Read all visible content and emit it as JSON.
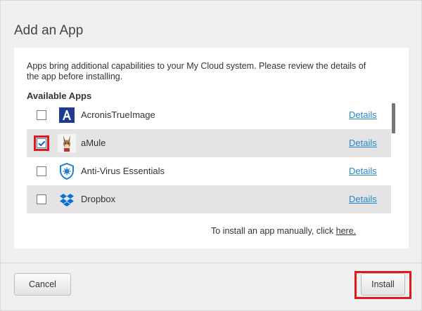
{
  "dialog": {
    "title": "Add an App",
    "intro": "Apps bring additional capabilities to your My Cloud system. Please review the details of the app before installing.",
    "section_label": "Available Apps",
    "apps": [
      {
        "name": "AcronisTrueImage",
        "details": "Details",
        "checked": false,
        "icon": "acronis-icon"
      },
      {
        "name": "aMule",
        "details": "Details",
        "checked": true,
        "icon": "amule-icon"
      },
      {
        "name": "Anti-Virus Essentials",
        "details": "Details",
        "checked": false,
        "icon": "antivirus-shield-icon"
      },
      {
        "name": "Dropbox",
        "details": "Details",
        "checked": false,
        "icon": "dropbox-icon"
      },
      {
        "name": "",
        "details": "",
        "checked": false,
        "icon": "app-icon"
      }
    ],
    "manual_text": "To install an app manually, click",
    "manual_link": "here.",
    "cancel_label": "Cancel",
    "install_label": "Install"
  },
  "colors": {
    "link": "#2589c8",
    "highlight": "#e01a1a",
    "acronis_blue": "#1f3a93",
    "dropbox_blue": "#0a70d6"
  }
}
